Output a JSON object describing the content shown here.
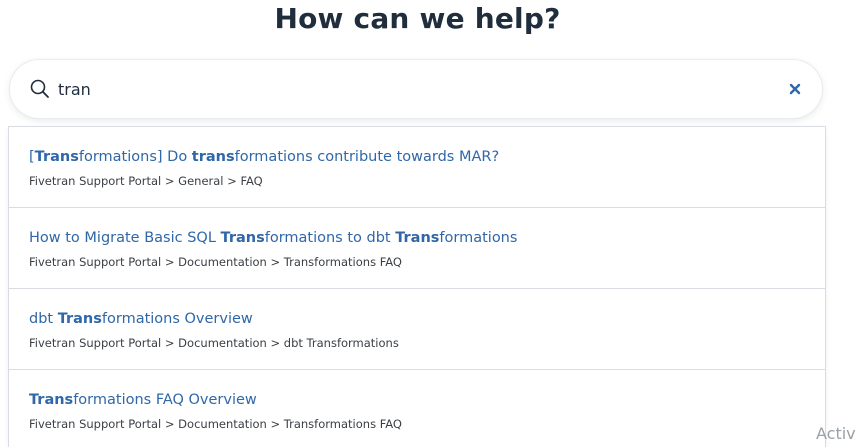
{
  "header": {
    "title": "How can we help?"
  },
  "search": {
    "value": "tran",
    "clear_icon": "close-icon",
    "search_icon": "search-icon"
  },
  "results": [
    {
      "title_parts": [
        {
          "text": "[",
          "bold": false
        },
        {
          "text": "Trans",
          "bold": true
        },
        {
          "text": "formations] Do ",
          "bold": false
        },
        {
          "text": "trans",
          "bold": true
        },
        {
          "text": "formations contribute towards MAR?",
          "bold": false
        }
      ],
      "path": "Fivetran Support Portal > General > FAQ"
    },
    {
      "title_parts": [
        {
          "text": "How to Migrate Basic SQL ",
          "bold": false
        },
        {
          "text": "Trans",
          "bold": true
        },
        {
          "text": "formations to dbt ",
          "bold": false
        },
        {
          "text": "Trans",
          "bold": true
        },
        {
          "text": "formations",
          "bold": false
        }
      ],
      "path": "Fivetran Support Portal > Documentation > Transformations FAQ"
    },
    {
      "title_parts": [
        {
          "text": "dbt ",
          "bold": false
        },
        {
          "text": "Trans",
          "bold": true
        },
        {
          "text": "formations Overview",
          "bold": false
        }
      ],
      "path": "Fivetran Support Portal > Documentation > dbt Transformations"
    },
    {
      "title_parts": [
        {
          "text": "Trans",
          "bold": true
        },
        {
          "text": "formations FAQ Overview",
          "bold": false
        }
      ],
      "path": "Fivetran Support Portal > Documentation > Transformations FAQ"
    }
  ],
  "overlay": {
    "activate_text": "Activ"
  },
  "colors": {
    "title": "#1f2d3d",
    "link": "#2f67a8",
    "path": "#3a3f45",
    "clear_icon": "#2f67a8"
  }
}
